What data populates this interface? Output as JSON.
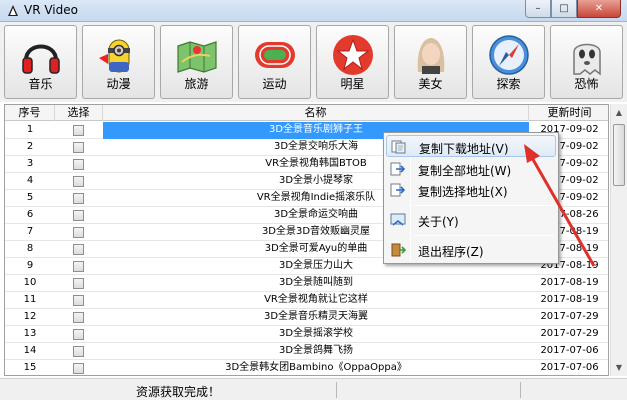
{
  "window": {
    "title": "VR Video",
    "controls": {
      "minimize": "–",
      "maximize": "□",
      "close": "✕"
    }
  },
  "toolbar": [
    {
      "label": "音乐",
      "icon": "headphones-icon"
    },
    {
      "label": "动漫",
      "icon": "minion-icon"
    },
    {
      "label": "旅游",
      "icon": "map-icon"
    },
    {
      "label": "运动",
      "icon": "track-icon"
    },
    {
      "label": "明星",
      "icon": "star-icon"
    },
    {
      "label": "美女",
      "icon": "girl-icon"
    },
    {
      "label": "探索",
      "icon": "compass-icon"
    },
    {
      "label": "恐怖",
      "icon": "ghost-icon"
    }
  ],
  "table": {
    "headers": {
      "index": "序号",
      "select": "选择",
      "name": "名称",
      "updated": "更新时间"
    },
    "rows": [
      {
        "index": "1",
        "name": "3D全景音乐剧狮子王",
        "updated": "2017-09-02"
      },
      {
        "index": "2",
        "name": "3D全景交响乐大海",
        "updated": "2017-09-02"
      },
      {
        "index": "3",
        "name": "VR全景视角韩国BTOB",
        "updated": "2017-09-02"
      },
      {
        "index": "4",
        "name": "3D全景小提琴家",
        "updated": "2017-09-02"
      },
      {
        "index": "5",
        "name": "VR全景视角Indie摇滚乐队",
        "updated": "2017-09-02"
      },
      {
        "index": "6",
        "name": "3D全景命运交响曲",
        "updated": "2017-08-26"
      },
      {
        "index": "7",
        "name": "3D全景3D音效贩幽灵屋",
        "updated": "2017-08-19"
      },
      {
        "index": "8",
        "name": "3D全景可爱Ayu的单曲",
        "updated": "2017-08-19"
      },
      {
        "index": "9",
        "name": "3D全景压力山大",
        "updated": "2017-08-19"
      },
      {
        "index": "10",
        "name": "3D全景随叫随到",
        "updated": "2017-08-19"
      },
      {
        "index": "11",
        "name": "VR全景视角就让它这样",
        "updated": "2017-08-19"
      },
      {
        "index": "12",
        "name": "3D全景音乐精灵天海翼",
        "updated": "2017-07-29"
      },
      {
        "index": "13",
        "name": "3D全景摇滚学校",
        "updated": "2017-07-29"
      },
      {
        "index": "14",
        "name": "3D全景鸽舞飞扬",
        "updated": "2017-07-06"
      },
      {
        "index": "15",
        "name": "3D全景韩女团Bambino《OppaOppa》",
        "updated": "2017-07-06"
      }
    ],
    "selected_row": 1
  },
  "context_menu": {
    "items": [
      {
        "label": "复制下载地址(V)",
        "icon": "copy-link-icon"
      },
      {
        "label": "复制全部地址(W)",
        "icon": "copy-all-icon"
      },
      {
        "label": "复制选择地址(X)",
        "icon": "copy-selected-icon"
      },
      {
        "label": "关于(Y)",
        "icon": "about-icon"
      },
      {
        "label": "退出程序(Z)",
        "icon": "exit-icon"
      }
    ],
    "hovered": 1
  },
  "status": {
    "text": "资源获取完成！"
  },
  "colors": {
    "selection": "#3399ff",
    "annotation_arrow": "#e0302a",
    "title_bar": "#c6d9ee"
  }
}
